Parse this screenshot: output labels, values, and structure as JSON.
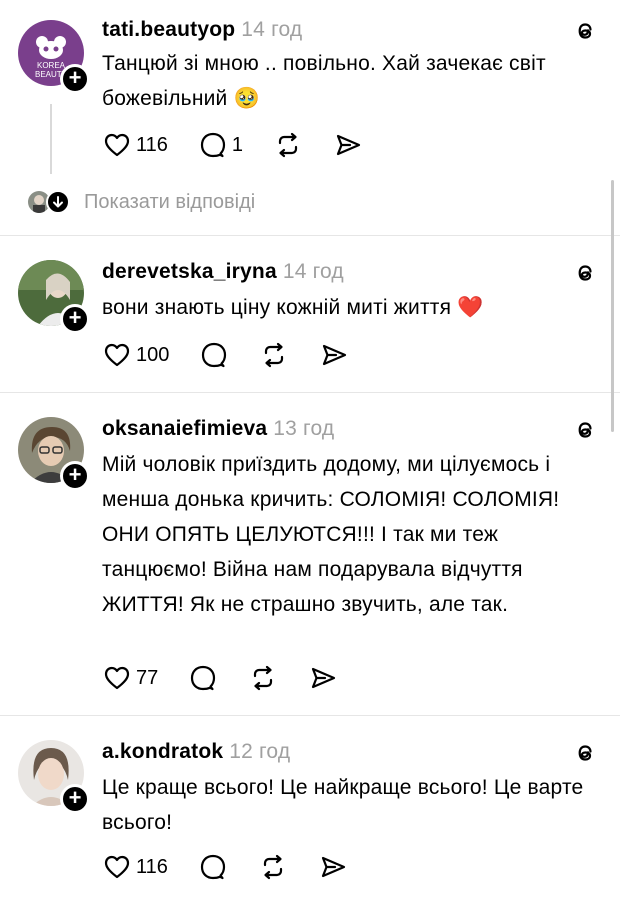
{
  "posts": [
    {
      "username": "tati.beautyop",
      "time": "14 год",
      "text": "Танцюй зі мною .. повільно. Хай зачекає світ божевільний 🥹",
      "likes": "116",
      "replies": "1"
    },
    {
      "username": "derevetska_iryna",
      "time": "14 год",
      "text": "вони знають ціну кожній миті життя ❤️",
      "likes": "100",
      "replies": ""
    },
    {
      "username": "oksanaiefimieva",
      "time": "13 год",
      "text": "Мій чоловік приїздить додому, ми цілуємось і менша донька кричить: СОЛОМІЯ! СОЛОМІЯ! ОНИ ОПЯТЬ ЦЕЛУЮТСЯ!!! І так ми теж танцюємо! Війна нам подарувала відчуття ЖИТТЯ! Як не страшно звучить, але так.",
      "likes": "77",
      "replies": ""
    },
    {
      "username": "a.kondratok",
      "time": "12 год",
      "text": "Це краще всього! Це найкраще всього! Це варте всього!",
      "likes": "116",
      "replies": ""
    }
  ],
  "show_replies_label": "Показати відповіді",
  "avatar_logo_text": "KOREA BEAUTY",
  "icons": {
    "like": "heart-icon",
    "reply": "comment-icon",
    "repost": "repost-icon",
    "share": "share-icon",
    "threads": "threads-icon",
    "follow": "plus-icon"
  }
}
